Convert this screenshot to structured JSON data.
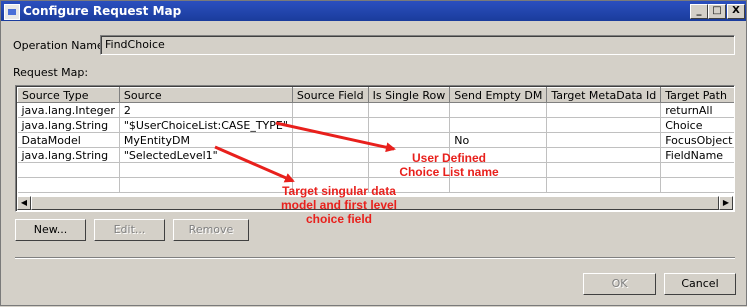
{
  "window": {
    "title": "Configure Request Map",
    "controls": [
      "_",
      "□",
      "X"
    ]
  },
  "operation": {
    "label": "Operation Name:",
    "value": "FindChoice"
  },
  "request_map": {
    "label": "Request Map:",
    "columns": [
      "Source Type",
      "Source",
      "Source Field",
      "Is Single Row",
      "Send Empty DM",
      "Target MetaData Id",
      "Target Path"
    ],
    "rows": [
      [
        "java.lang.Integer",
        "2",
        "",
        "",
        "",
        "",
        "returnAll"
      ],
      [
        "java.lang.String",
        "\"$UserChoiceList:CASE_TYPE\"",
        "",
        "",
        "",
        "",
        "Choice"
      ],
      [
        "DataModel",
        "MyEntityDM",
        "",
        "",
        "No",
        "",
        "FocusObject"
      ],
      [
        "java.lang.String",
        "\"SelectedLevel1\"",
        "",
        "",
        "",
        "",
        "FieldName"
      ],
      [
        "",
        "",
        "",
        "",
        "",
        "",
        ""
      ],
      [
        "",
        "",
        "",
        "",
        "",
        "",
        ""
      ]
    ]
  },
  "buttons": {
    "new": "New...",
    "edit": "Edit...",
    "remove": "Remove",
    "ok": "OK",
    "cancel": "Cancel"
  },
  "annotations": {
    "note1_line1": "User Defined",
    "note1_line2": "Choice List name",
    "note2_line1": "Target singular data",
    "note2_line2": "model and first level",
    "note2_line3": "choice field",
    "color": "#e8201c"
  }
}
